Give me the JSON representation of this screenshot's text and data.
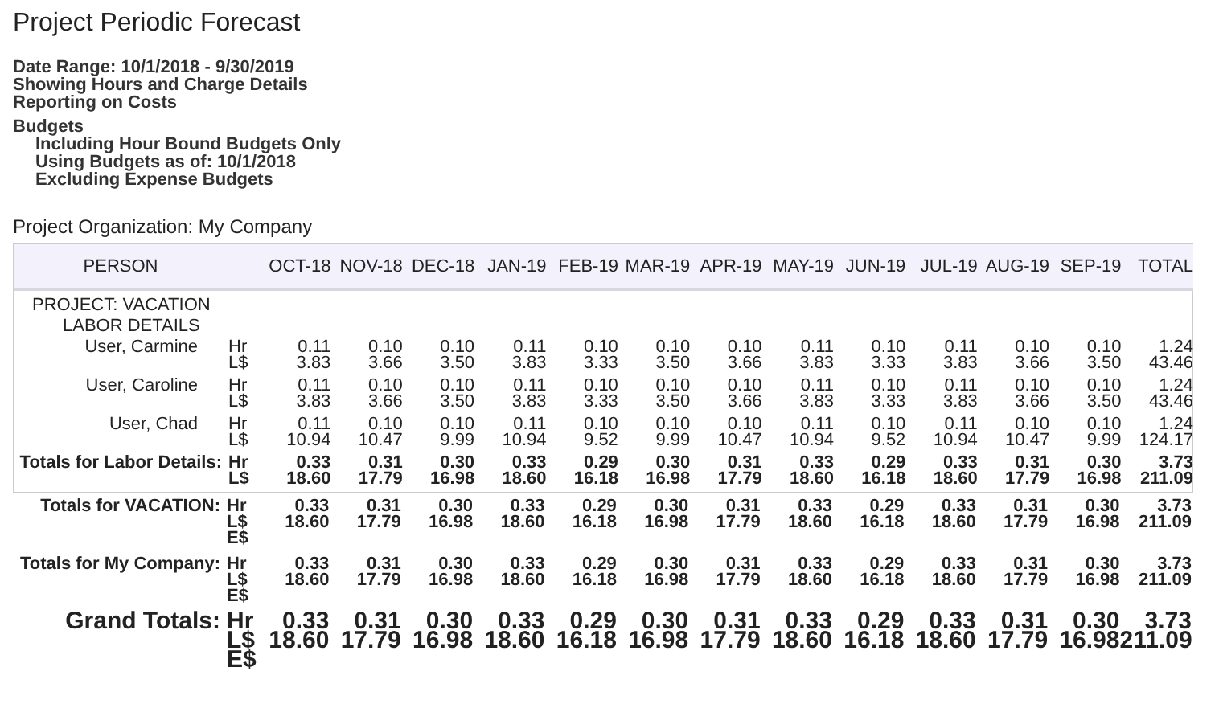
{
  "title": "Project Periodic Forecast",
  "criteria": [
    "Date Range:  10/1/2018 - 9/30/2019",
    "Showing Hours and Charge Details",
    "Reporting on Costs"
  ],
  "budgets": {
    "label": "Budgets",
    "children": [
      "Including Hour Bound Budgets Only",
      "Using Budgets as of:  10/1/2018",
      "Excluding Expense Budgets"
    ]
  },
  "organization": "Project Organization:  My Company",
  "table": {
    "columns": [
      "PERSON",
      "OCT-18",
      "NOV-18",
      "DEC-18",
      "JAN-19",
      "FEB-19",
      "MAR-19",
      "APR-19",
      "MAY-19",
      "JUN-19",
      "JUL-19",
      "AUG-19",
      "SEP-19",
      "TOTAL"
    ],
    "rows": [
      {
        "kind": "project",
        "label": "PROJECT:  VACATION",
        "lines": []
      },
      {
        "kind": "section",
        "label": "LABOR DETAILS",
        "lines": []
      },
      {
        "kind": "person",
        "label": "User, Carmine",
        "lines": [
          {
            "unit": "Hr",
            "values": [
              "0.11",
              "0.10",
              "0.10",
              "0.11",
              "0.10",
              "0.10",
              "0.10",
              "0.11",
              "0.10",
              "0.11",
              "0.10",
              "0.10",
              "1.24"
            ]
          },
          {
            "unit": "L$",
            "values": [
              "3.83",
              "3.66",
              "3.50",
              "3.83",
              "3.33",
              "3.50",
              "3.66",
              "3.83",
              "3.33",
              "3.83",
              "3.66",
              "3.50",
              "43.46"
            ]
          }
        ]
      },
      {
        "kind": "person",
        "label": "User, Caroline",
        "lines": [
          {
            "unit": "Hr",
            "values": [
              "0.11",
              "0.10",
              "0.10",
              "0.11",
              "0.10",
              "0.10",
              "0.10",
              "0.11",
              "0.10",
              "0.11",
              "0.10",
              "0.10",
              "1.24"
            ]
          },
          {
            "unit": "L$",
            "values": [
              "3.83",
              "3.66",
              "3.50",
              "3.83",
              "3.33",
              "3.50",
              "3.66",
              "3.83",
              "3.33",
              "3.83",
              "3.66",
              "3.50",
              "43.46"
            ]
          }
        ]
      },
      {
        "kind": "person",
        "label": "User, Chad",
        "lines": [
          {
            "unit": "Hr",
            "values": [
              "0.11",
              "0.10",
              "0.10",
              "0.11",
              "0.10",
              "0.10",
              "0.10",
              "0.11",
              "0.10",
              "0.11",
              "0.10",
              "0.10",
              "1.24"
            ]
          },
          {
            "unit": "L$",
            "values": [
              "10.94",
              "10.47",
              "9.99",
              "10.94",
              "9.52",
              "9.99",
              "10.47",
              "10.94",
              "9.52",
              "10.94",
              "10.47",
              "9.99",
              "124.17"
            ]
          }
        ]
      },
      {
        "kind": "subtotal",
        "label": "Totals for Labor Details:",
        "lines": [
          {
            "unit": "Hr",
            "values": [
              "0.33",
              "0.31",
              "0.30",
              "0.33",
              "0.29",
              "0.30",
              "0.31",
              "0.33",
              "0.29",
              "0.33",
              "0.31",
              "0.30",
              "3.73"
            ]
          },
          {
            "unit": "L$",
            "values": [
              "18.60",
              "17.79",
              "16.98",
              "18.60",
              "16.18",
              "16.98",
              "17.79",
              "18.60",
              "16.18",
              "18.60",
              "17.79",
              "16.98",
              "211.09"
            ]
          }
        ]
      }
    ],
    "totals": [
      {
        "kind": "total",
        "label": "Totals for VACATION:",
        "lines": [
          {
            "unit": "Hr",
            "values": [
              "0.33",
              "0.31",
              "0.30",
              "0.33",
              "0.29",
              "0.30",
              "0.31",
              "0.33",
              "0.29",
              "0.33",
              "0.31",
              "0.30",
              "3.73"
            ]
          },
          {
            "unit": "L$",
            "values": [
              "18.60",
              "17.79",
              "16.98",
              "18.60",
              "16.18",
              "16.98",
              "17.79",
              "18.60",
              "16.18",
              "18.60",
              "17.79",
              "16.98",
              "211.09"
            ]
          },
          {
            "unit": "E$"
          }
        ]
      },
      {
        "kind": "total",
        "label": "Totals for My Company:",
        "lines": [
          {
            "unit": "Hr",
            "values": [
              "0.33",
              "0.31",
              "0.30",
              "0.33",
              "0.29",
              "0.30",
              "0.31",
              "0.33",
              "0.29",
              "0.33",
              "0.31",
              "0.30",
              "3.73"
            ]
          },
          {
            "unit": "L$",
            "values": [
              "18.60",
              "17.79",
              "16.98",
              "18.60",
              "16.18",
              "16.98",
              "17.79",
              "18.60",
              "16.18",
              "18.60",
              "17.79",
              "16.98",
              "211.09"
            ]
          },
          {
            "unit": "E$"
          }
        ]
      },
      {
        "kind": "grand",
        "label": "Grand Totals:",
        "lines": [
          {
            "unit": "Hr",
            "values": [
              "0.33",
              "0.31",
              "0.30",
              "0.33",
              "0.29",
              "0.30",
              "0.31",
              "0.33",
              "0.29",
              "0.33",
              "0.31",
              "0.30",
              "3.73"
            ]
          },
          {
            "unit": "L$",
            "values": [
              "18.60",
              "17.79",
              "16.98",
              "18.60",
              "16.18",
              "16.98",
              "17.79",
              "18.60",
              "16.18",
              "18.60",
              "17.79",
              "16.98",
              "211.09"
            ]
          },
          {
            "unit": "E$"
          }
        ]
      }
    ]
  }
}
